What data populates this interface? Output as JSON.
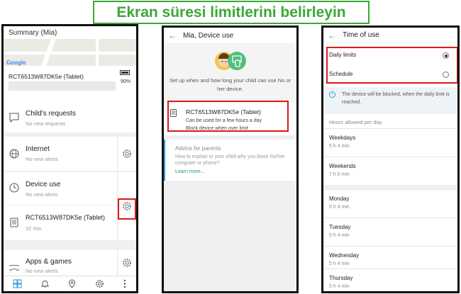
{
  "banner": {
    "title": "Ekran süresi limitlerini belirleyin"
  },
  "colors": {
    "highlight": "#e0161b",
    "accent_green": "#3aa835",
    "link_green": "#1f9d55",
    "info_blue": "#2c9ad6"
  },
  "screen1": {
    "title": "Summary (Mia)",
    "map_logo": "Google",
    "device": {
      "name": "RCT6513W87DK5e (Tablet)",
      "battery": "90%"
    },
    "rows": [
      {
        "title": "Child's requests",
        "sub": "No new requests",
        "icon": "message-icon"
      },
      {
        "title": "Internet",
        "sub": "No new alerts",
        "icon": "globe-icon"
      },
      {
        "title": "Device use",
        "sub": "No new alerts",
        "icon": "clock-icon"
      },
      {
        "title": "RCT6513W87DK5e (Tablet)",
        "sub": "32 min",
        "icon": "tablet-icon"
      },
      {
        "title": "Apps & games",
        "sub": "No new alerts",
        "icon": "gamepad-icon"
      }
    ],
    "bottom_nav": [
      "dashboard-icon",
      "bell-icon",
      "location-pin-icon",
      "settings-icon",
      "more-icon"
    ]
  },
  "screen2": {
    "title": "Mia, Device use",
    "description": "Set up when and how long your child can use his or her device.",
    "card": {
      "device": "RCT6513W87DK5e (Tablet)",
      "line1": "Can be used for a few hours a day",
      "line2": "Block device when over limit"
    },
    "advice": {
      "title": "Advice for parents",
      "text": "How to explain to your child why you block his/her computer or phone?",
      "link": "Learn more..."
    }
  },
  "screen3": {
    "title": "Time of use",
    "options": [
      {
        "label": "Daily limits",
        "selected": true
      },
      {
        "label": "Schedule",
        "selected": false
      }
    ],
    "info": "The device will be blocked, when the daily limit is reached.",
    "hours_label": "Hours allowed per day",
    "days": [
      {
        "name": "Weekdays",
        "value": "5 h 4 min"
      },
      {
        "name": "Weekends",
        "value": "7 h 0 min"
      },
      {
        "name": "Monday",
        "value": "5 h 4 min"
      },
      {
        "name": "Tuesday",
        "value": "5 h 4 min"
      },
      {
        "name": "Wednesday",
        "value": "5 h 4 min"
      },
      {
        "name": "Thursday",
        "value": "5 h 4 min"
      }
    ]
  }
}
